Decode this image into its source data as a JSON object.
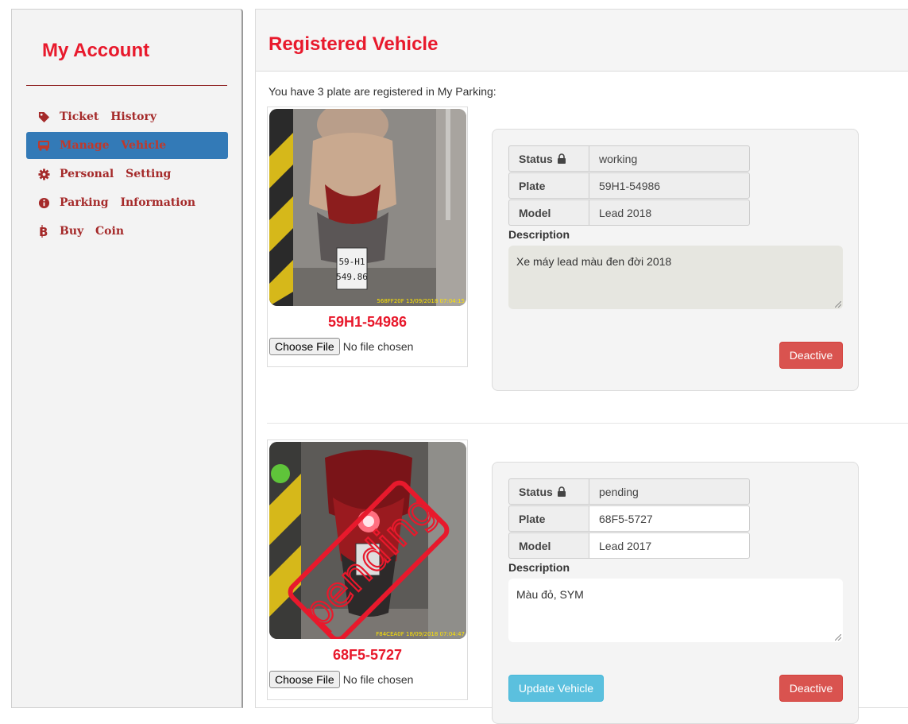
{
  "sidebar": {
    "title": "My Account",
    "items": [
      {
        "label": "Ticket History",
        "icon": "tag-icon",
        "active": false
      },
      {
        "label": "Manage Vehicle",
        "icon": "bus-icon",
        "active": true
      },
      {
        "label": "Personal Setting",
        "icon": "gear-icon",
        "active": false
      },
      {
        "label": "Parking Information",
        "icon": "info-circle-icon",
        "active": false
      },
      {
        "label": "Buy Coin",
        "icon": "bitcoin-icon",
        "active": false
      }
    ]
  },
  "main": {
    "title": "Registered Vehicle",
    "intro": "You have 3 plate are registered in My Parking:",
    "choose_file_label": "Choose File",
    "no_file_label": "No file chosen",
    "status_label": "Status",
    "plate_label": "Plate",
    "model_label": "Model",
    "description_label": "Description",
    "deactive_label": "Deactive",
    "update_label": "Update Vehicle",
    "vehicles": [
      {
        "plate": "59H1-54986",
        "status": "working",
        "model": "Lead 2018",
        "description": "Xe máy lead màu đen đời 2018",
        "photo_caption": "568FF20F 13/09/2018 07:04:15",
        "plate_sign_top": "59-H1",
        "plate_sign_bottom": "549.86"
      },
      {
        "plate": "68F5-5727",
        "status": "pending",
        "model": "Lead 2017",
        "description": "Màu đỏ, SYM",
        "photo_caption": "F84CEA0F 18/09/2018 07:04:47",
        "stamp": "pending"
      }
    ]
  },
  "colors": {
    "brand_red": "#e8192c",
    "active_nav": "#337ab7",
    "deactive": "#d9534f",
    "update": "#5bc0de"
  }
}
